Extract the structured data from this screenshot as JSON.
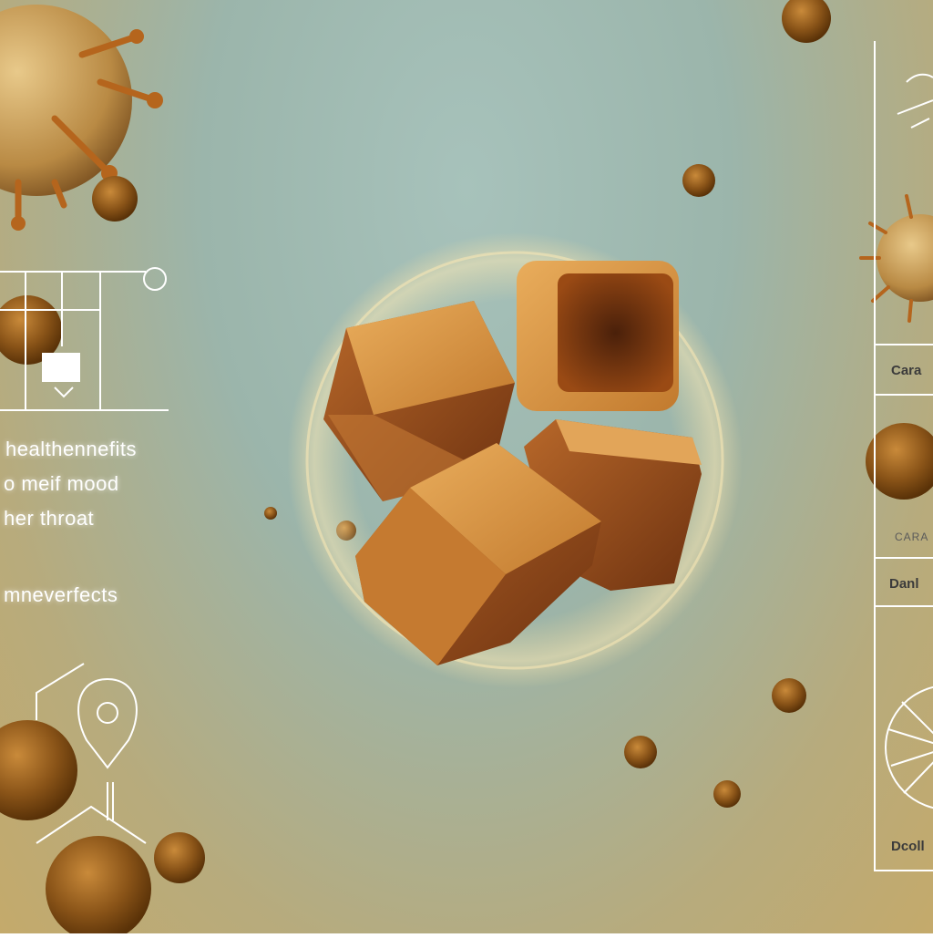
{
  "left_panel": {
    "lines": [
      "healthennefits",
      "o meif mood",
      "her throat",
      "mneverfects"
    ]
  },
  "right_panel": {
    "labels": [
      "Cara",
      "CARA",
      "Danl",
      "Dcoll"
    ]
  },
  "colors": {
    "caramel_light": "#d9973f",
    "caramel_dark": "#7a3a12",
    "spore": "#8a5a1e",
    "glow": "#f2dca0"
  }
}
